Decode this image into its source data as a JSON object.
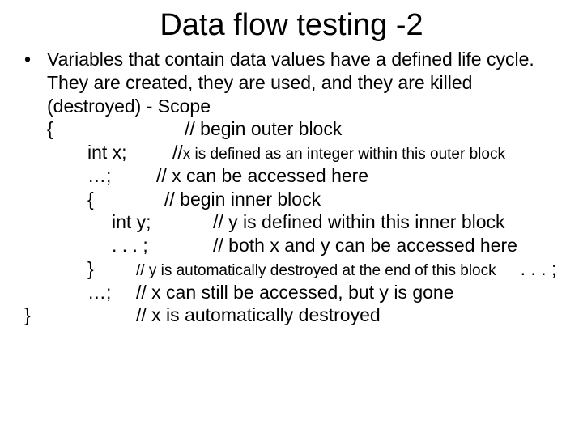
{
  "title": "Data flow testing -2",
  "bullet": {
    "dot": "•",
    "text": "Variables that contain data values have a defined life cycle. They are created, they are used, and they are killed (destroyed) - Scope"
  },
  "lines": {
    "l1_a": "{",
    "l1_b": "// begin outer block",
    "l2_a": "int x;",
    "l2_b": "// ",
    "l2_c": "x is defined as an integer within this outer block",
    "l3_a": "…;",
    "l3_b": "// x can be accessed here",
    "l4_a": "{",
    "l4_b": "// begin inner block",
    "l5_a": "int y;",
    "l5_b": "// y is defined within this inner block",
    "l6_a": ". . . ;",
    "l6_b": "// both x and y can be accessed here",
    "l7_a": "}",
    "l7_b": "// y is automatically destroyed at the end of this block",
    "l7_c": ". . . ;",
    "l8_a": "…;",
    "l8_b": "// x can still be accessed, but y is gone",
    "l9_a": "}",
    "l9_b": "// x is automatically destroyed"
  }
}
